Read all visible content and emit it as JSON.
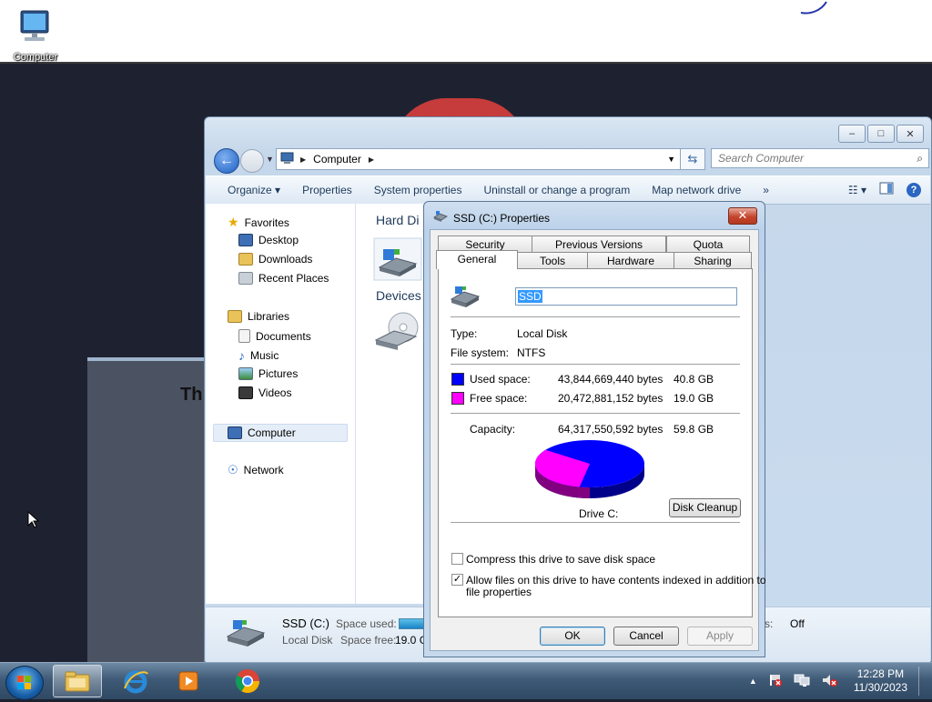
{
  "desktop": {
    "icon_label": "Computer",
    "bg_window_text": "Th"
  },
  "explorer": {
    "address": "Computer",
    "search_placeholder": "Search Computer",
    "commands": [
      "Organize",
      "Properties",
      "System properties",
      "Uninstall or change a program",
      "Map network drive"
    ],
    "more_label": "»",
    "nav": {
      "favorites": "Favorites",
      "desktop": "Desktop",
      "downloads": "Downloads",
      "recent": "Recent Places",
      "libraries": "Libraries",
      "documents": "Documents",
      "music": "Music",
      "pictures": "Pictures",
      "videos": "Videos",
      "computer": "Computer",
      "network": "Network"
    },
    "groups": {
      "hard_disk": "Hard Di",
      "devices": "Devices"
    },
    "status": {
      "drive_name": "SSD (C:)",
      "drive_type": "Local Disk",
      "space_used_label": "Space used:",
      "space_free_label": "Space free:",
      "space_free_value": "19.0 G",
      "bitlocker_label": "tus:",
      "bitlocker_value": "Off"
    }
  },
  "dialog": {
    "title": "SSD (C:) Properties",
    "tabs_row1": [
      "Security",
      "Previous Versions",
      "Quota"
    ],
    "tabs_row2": [
      "General",
      "Tools",
      "Hardware",
      "Sharing"
    ],
    "active_tab": "General",
    "volume_name": "SSD",
    "type_label": "Type:",
    "type_value": "Local Disk",
    "fs_label": "File system:",
    "fs_value": "NTFS",
    "used": {
      "label": "Used space:",
      "bytes": "43,844,669,440 bytes",
      "gb": "40.8 GB",
      "color": "#0000ff"
    },
    "free": {
      "label": "Free space:",
      "bytes": "20,472,881,152 bytes",
      "gb": "19.0 GB",
      "color": "#ff00ff"
    },
    "capacity": {
      "label": "Capacity:",
      "bytes": "64,317,550,592 bytes",
      "gb": "59.8 GB"
    },
    "used_fraction": 0.68,
    "drive_label": "Drive C:",
    "cleanup_label": "Disk Cleanup",
    "compress_label": "Compress this drive to save disk space",
    "compress_checked": false,
    "index_label_1": "Allow files on this drive to have contents indexed in addition to",
    "index_label_2": "file properties",
    "index_checked": true,
    "ok": "OK",
    "cancel": "Cancel",
    "apply": "Apply"
  },
  "taskbar": {
    "time": "12:28 PM",
    "date": "11/30/2023",
    "tray_arrow": "▲"
  }
}
